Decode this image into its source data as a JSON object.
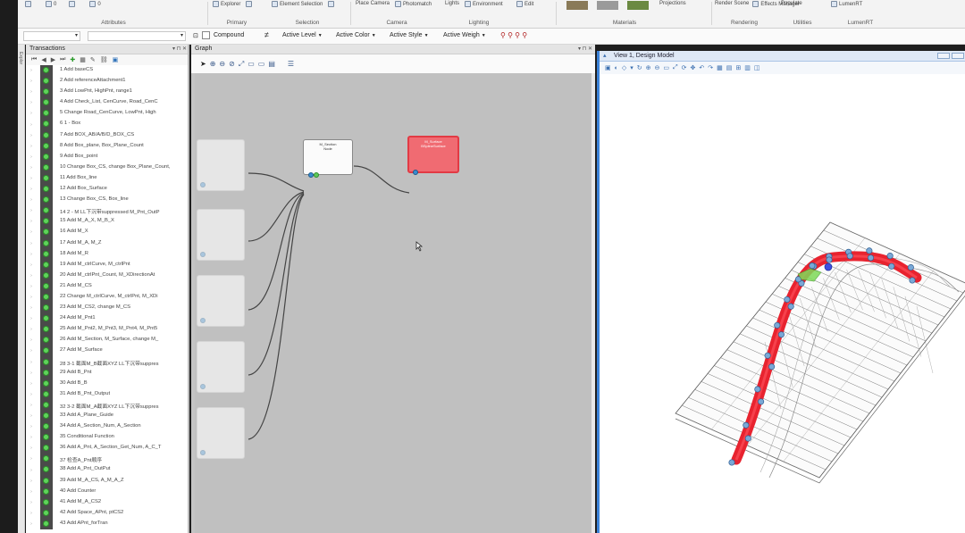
{
  "ribbon": {
    "groups": [
      {
        "label": "Attributes",
        "items": [
          "",
          "0",
          "",
          "0"
        ]
      },
      {
        "label": "Primary",
        "items": [
          "Explorer",
          ""
        ]
      },
      {
        "label": "Selection",
        "items": [
          "Element Selection",
          ""
        ]
      },
      {
        "label": "Camera",
        "items": [
          "Place Camera",
          "Photomatch"
        ]
      },
      {
        "label": "Lighting",
        "items": [
          "Lights",
          "Environment"
        ]
      },
      {
        "label": "",
        "items": [
          "Edit"
        ]
      },
      {
        "label": "Materials",
        "items": []
      },
      {
        "label": "",
        "items": [
          "Projections"
        ]
      },
      {
        "label": "Rendering",
        "items": [
          "Render Scene",
          "Effects Manager"
        ]
      },
      {
        "label": "Utilities",
        "items": [
          "Populate"
        ]
      },
      {
        "label": "LumenRT",
        "items": [
          "LumenRT"
        ]
      }
    ],
    "material_colors": [
      "#8a7a58",
      "#9a9a9a",
      "#6b8a42"
    ]
  },
  "toolbar": {
    "compound": "Compound",
    "active_level": "Active Level",
    "active_color": "Active Color",
    "active_style": "Active Style",
    "active_weight": "Active Weigh"
  },
  "side_tab": "Explor",
  "transactions": {
    "title": "Transactions",
    "items": [
      "1  Add baseCS",
      "2  Add referenceAttachment1",
      "3  Add LowPnt, HighPnt, range1",
      "4  Add Check_List, CenCurve, Road_CenC",
      "5  Change Road_CenCurve, LowPnt, High",
      "6  1 - Box",
      "7  Add BOX_AB/A/B/D_BOX_CS",
      "8  Add Box_plane, Box_Plane_Count",
      "9  Add Box_point",
      "10  Change Box_CS, change Box_Plane_Count,",
      "11  Add Box_line",
      "12  Add Box_Surface",
      "13  Change Box_CS, Box_line",
      "14  2 - M LL下沉带suppressed M_Pnt_OutP",
      "15  Add M_A_X, M_B_X",
      "16  Add M_X",
      "17  Add M_A, M_Z",
      "18  Add M_R",
      "19  Add M_ctrlCurve, M_ctrlPnt",
      "20  Add M_ctrlPnt_Count, M_XDirectionAt",
      "21  Add M_CS",
      "22  Change M_ctrlCurve, M_ctrlPnt, M_XDi",
      "23  Add M_CS2, change M_CS",
      "24  Add M_Pnt1",
      "25  Add M_Pnt2, M_Pnt3, M_Pnt4, M_Pnt5",
      "26  Add M_Section, M_Surface, change M_",
      "27  Add M_Surface",
      "28  3-1 截面M_B截面XYZ LL下沉带suppres",
      "29  Add B_Pnt",
      "30  Add B_B",
      "31  Add B_Pnt_Output",
      "32  3-2 截面M_A截面XYZ LL下沉带suppres",
      "33  Add A_Plane_Guide",
      "34  Add A_Section_Num, A_Section",
      "35  Conditional Function",
      "36  Add A_Pnt, A_Section_Get_Num, A_C_T",
      "37  检查A_Pnt顺序",
      "38  Add A_Pnt_OutPut",
      "39  Add M_A_CS, A_M_A_Z",
      "40  Add Counter",
      "41  Add M_A_CS2",
      "42  Add Space_APnt, ptCS2",
      "43  Add APnt_forTran"
    ]
  },
  "graph": {
    "title": "Graph",
    "nodes": [
      {
        "name": "M_Section",
        "sub": "Node"
      },
      {
        "name": "M_Surface",
        "sub": "BSplineSurface"
      }
    ]
  },
  "view": {
    "title": "View 1, Design Model"
  }
}
